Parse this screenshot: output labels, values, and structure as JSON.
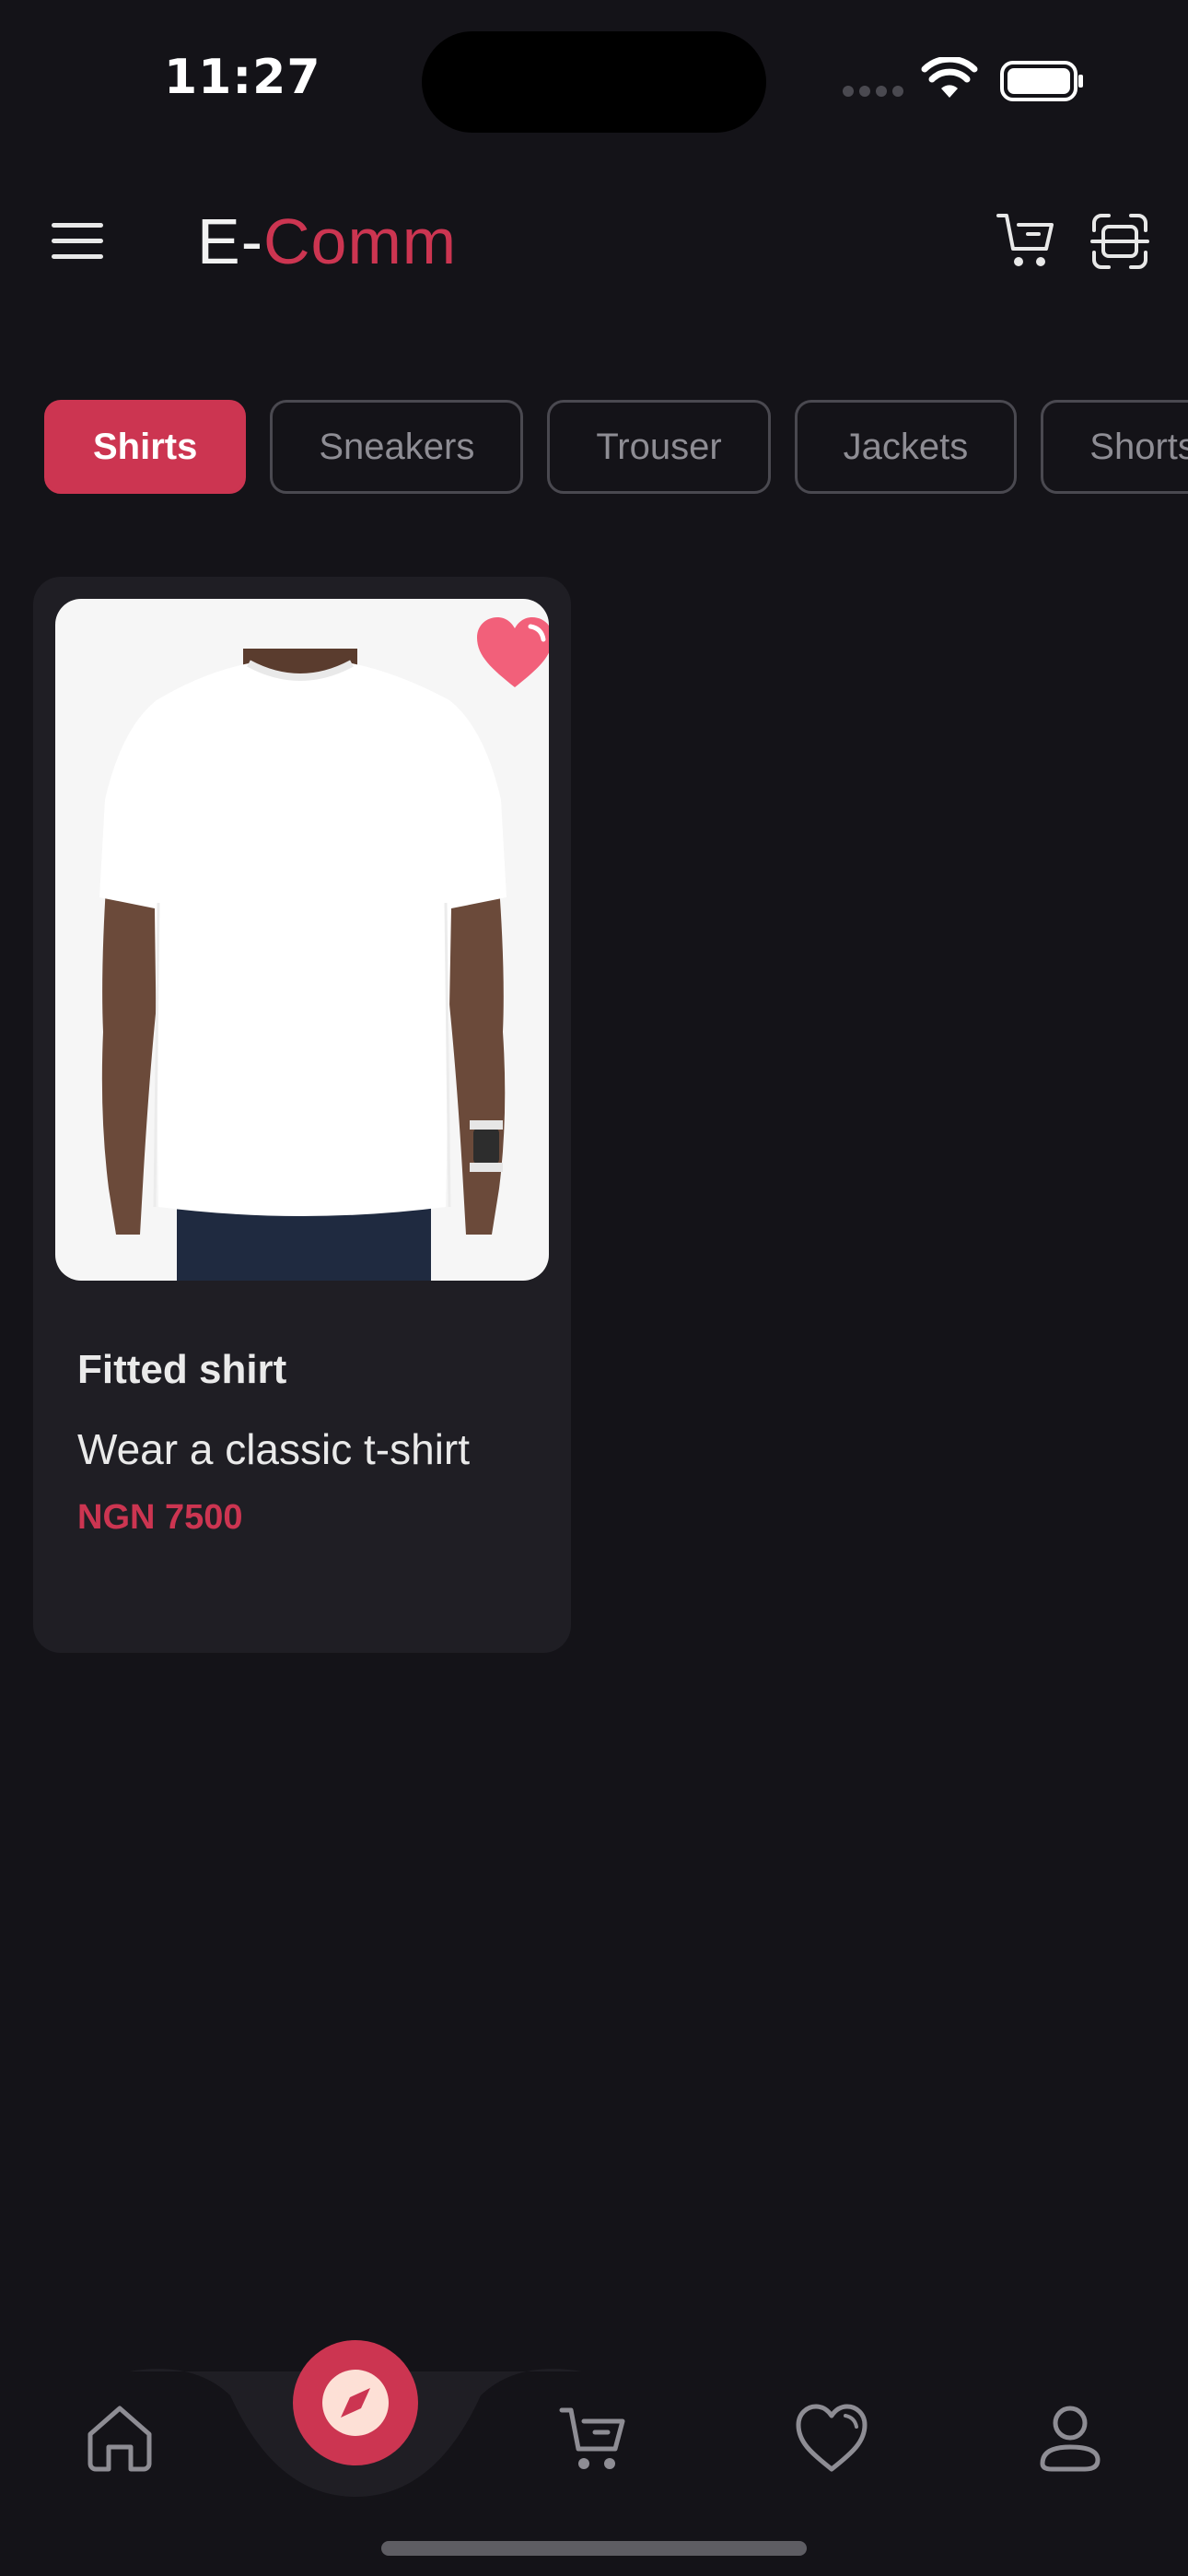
{
  "status": {
    "time": "11:27"
  },
  "header": {
    "logo_prefix": "E-",
    "logo_suffix": "Comm"
  },
  "categories": [
    {
      "label": "Shirts",
      "active": true
    },
    {
      "label": "Sneakers",
      "active": false
    },
    {
      "label": "Trouser",
      "active": false
    },
    {
      "label": "Jackets",
      "active": false
    },
    {
      "label": "Shorts",
      "active": false
    }
  ],
  "products": [
    {
      "name": "Fitted shirt",
      "description": "Wear a classic t-shirt",
      "price": "NGN 7500",
      "favorite": true
    }
  ],
  "bottom_nav": {
    "items": [
      "home-icon",
      "compass-icon",
      "cart-icon",
      "heart-icon",
      "user-icon"
    ],
    "active": "compass-icon"
  },
  "colors": {
    "background": "#141318",
    "card": "#1f1e24",
    "accent": "#cc3551",
    "favorite": "#f2607a"
  }
}
